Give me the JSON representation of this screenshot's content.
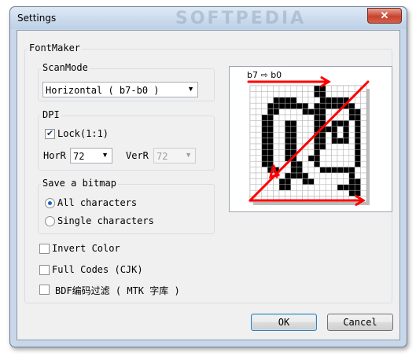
{
  "window": {
    "title": "Settings",
    "watermark": "SOFTPEDIA",
    "close_glyph": "✕"
  },
  "fontmaker": {
    "label": "FontMaker",
    "scanmode": {
      "label": "ScanMode",
      "value": "Horizontal ( b7-b0 )"
    },
    "dpi": {
      "label": "DPI",
      "lock": {
        "label": "Lock(1:1)",
        "checked": true
      },
      "horr": {
        "label": "HorR",
        "value": "72"
      },
      "verr": {
        "label": "VerR",
        "value": "72",
        "disabled": true
      }
    },
    "save_bitmap": {
      "label": "Save a bitmap",
      "options": [
        {
          "label": "All characters",
          "checked": true
        },
        {
          "label": "Single characters",
          "checked": false
        }
      ]
    },
    "options": [
      {
        "label": "Invert Color",
        "checked": false
      },
      {
        "label": "Full Codes (CJK)",
        "checked": false
      },
      {
        "label": "BDF编码过滤 ( MTK 字库 )",
        "checked": false
      }
    ],
    "preview": {
      "caption": "b7 ⇨ b0",
      "pixel_color": "#000000",
      "arrow_color": "#ff0000",
      "grid_color": "#b0b0b0"
    }
  },
  "buttons": {
    "ok": "OK",
    "cancel": "Cancel"
  }
}
